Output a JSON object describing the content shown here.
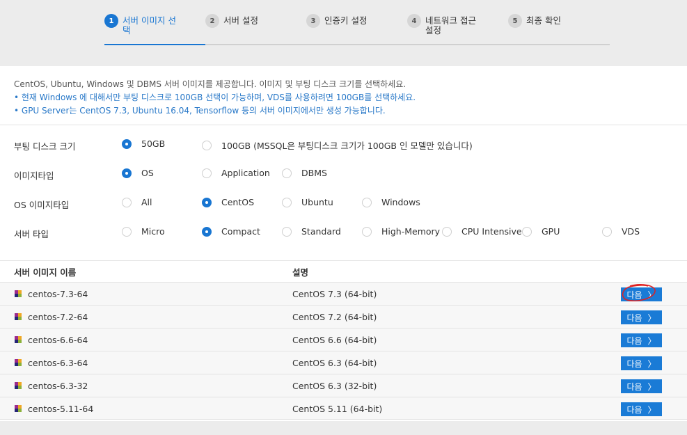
{
  "steps": [
    {
      "num": "1",
      "label": "서버 이미지 선\n택"
    },
    {
      "num": "2",
      "label": "서버 설정"
    },
    {
      "num": "3",
      "label": "인증키 설정"
    },
    {
      "num": "4",
      "label": "네트워크 접근\n설정"
    },
    {
      "num": "5",
      "label": "최종 확인"
    }
  ],
  "info": {
    "line1": "CentOS, Ubuntu, Windows 및 DBMS 서버 이미지를 제공합니다. 이미지 및 부팅 디스크 크기를 선택하세요.",
    "bullet1": "• 현재 Windows 에 대해서만 부팅 디스크로 100GB 선택이 가능하며, VDS를 사용하려면 100GB를 선택하세요.",
    "bullet2": "• GPU Server는 CentOS 7.3, Ubuntu 16.04, Tensorflow 등의 서버 이미지에서만 생성 가능합니다."
  },
  "options": {
    "boot_disk": {
      "label": "부팅 디스크 크기",
      "choices": [
        "50GB",
        "100GB (MSSQL은 부팅디스크 크기가 100GB 인 모델만 있습니다)"
      ],
      "selected": "50GB"
    },
    "image_type": {
      "label": "이미지타입",
      "choices": [
        "OS",
        "Application",
        "DBMS"
      ],
      "selected": "OS"
    },
    "os_image_type": {
      "label": "OS 이미지타입",
      "choices": [
        "All",
        "CentOS",
        "Ubuntu",
        "Windows"
      ],
      "selected": "CentOS"
    },
    "server_type": {
      "label": "서버 타입",
      "choices": [
        "Micro",
        "Compact",
        "Standard",
        "High-Memory",
        "CPU Intensive",
        "GPU",
        "VDS"
      ],
      "selected": "Compact"
    }
  },
  "table": {
    "col_name": "서버 이미지 이름",
    "col_desc": "설명",
    "button_label": "다음",
    "rows": [
      {
        "name": "centos-7.3-64",
        "desc": "CentOS 7.3 (64-bit)"
      },
      {
        "name": "centos-7.2-64",
        "desc": "CentOS 7.2 (64-bit)"
      },
      {
        "name": "centos-6.6-64",
        "desc": "CentOS 6.6 (64-bit)"
      },
      {
        "name": "centos-6.3-64",
        "desc": "CentOS 6.3 (64-bit)"
      },
      {
        "name": "centos-6.3-32",
        "desc": "CentOS 6.3 (32-bit)"
      },
      {
        "name": "centos-5.11-64",
        "desc": "CentOS 5.11 (64-bit)"
      }
    ]
  },
  "colors": {
    "accent": "#1976d2",
    "annotation": "#e02020"
  },
  "icons": {
    "row_icon": "centos-logo-icon",
    "button_icon": "chevron-right-icon"
  }
}
